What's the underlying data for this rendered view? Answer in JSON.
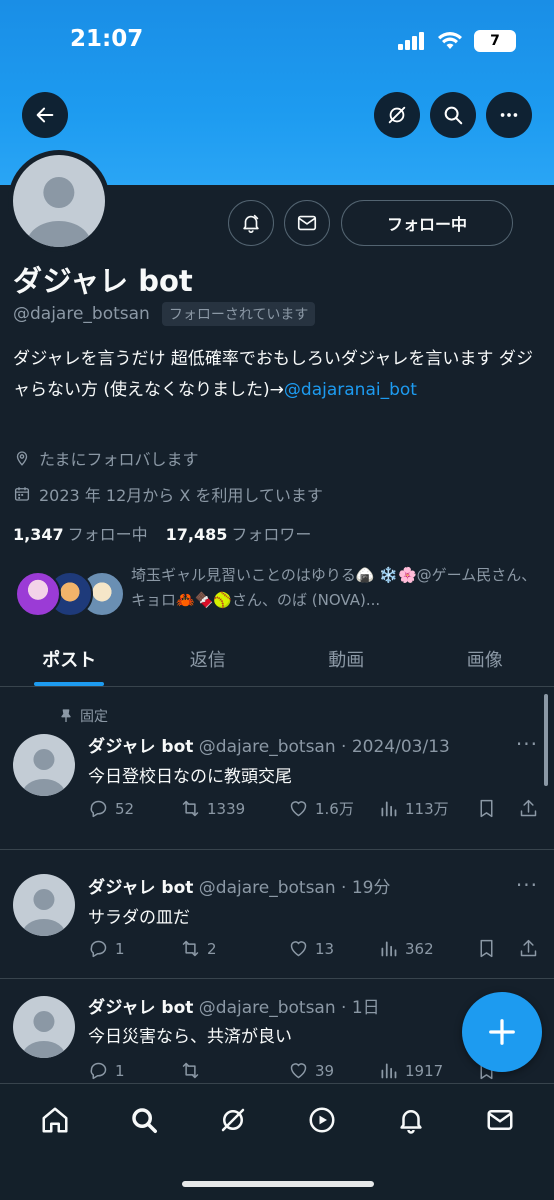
{
  "status_bar": {
    "time": "21:07",
    "battery": "7"
  },
  "profile": {
    "name": "ダジャレ bot",
    "handle": "@dajare_botsan",
    "follows_you": "フォローされています",
    "follow_button": "フォロー中",
    "bio_text": "ダジャレを言うだけ 超低確率でおもしろいダジャレを言います ダジャらない方 (使えなくなりました)→",
    "bio_link": "@dajaranai_bot",
    "location": "たまにフォロバします",
    "joined": "2023 年 12月から X を利用しています",
    "following_count": "1,347",
    "following_label": "フォロー中",
    "followers_count": "17,485",
    "followers_label": "フォロワー",
    "followed_by": "埼玉ギャル見習いことのはゆりる🍙 ❄️🌸@ゲーム民さん、キョロ🦀🍫🥎さん、のば (NOVA)..."
  },
  "tabs": [
    {
      "label": "ポスト",
      "active": true
    },
    {
      "label": "返信",
      "active": false
    },
    {
      "label": "動画",
      "active": false
    },
    {
      "label": "画像",
      "active": false
    }
  ],
  "pinned_label": "固定",
  "tweets": [
    {
      "name": "ダジャレ bot",
      "meta": "@dajare_botsan · 2024/03/13",
      "text": "今日登校日なのに教頭交尾",
      "replies": "52",
      "retweets": "1339",
      "likes": "1.6万",
      "views": "113万"
    },
    {
      "name": "ダジャレ bot",
      "meta": "@dajare_botsan · 19分",
      "text": "サラダの皿だ",
      "replies": "1",
      "retweets": "2",
      "likes": "13",
      "views": "362"
    },
    {
      "name": "ダジャレ bot",
      "meta": "@dajare_botsan · 1日",
      "text": "今日災害なら、共済が良い",
      "replies": "1",
      "retweets": "",
      "likes": "39",
      "views": "1917"
    }
  ],
  "colors": {
    "accent": "#1d9bf0",
    "background": "#15202b",
    "muted": "#8b98a5",
    "border": "#38444d"
  },
  "icons": [
    "back-arrow-icon",
    "grok-icon",
    "search-icon",
    "more-icon",
    "notification-bell-icon",
    "mail-icon",
    "location-icon",
    "calendar-icon",
    "pin-icon",
    "reply-icon",
    "retweet-icon",
    "like-icon",
    "views-icon",
    "bookmark-icon",
    "share-icon",
    "compose-plus-icon",
    "home-icon",
    "play-icon",
    "bell-icon"
  ]
}
